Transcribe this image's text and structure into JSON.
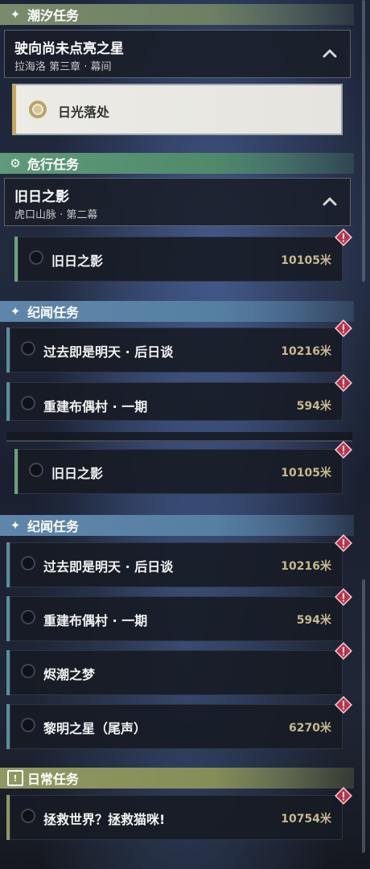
{
  "sections": {
    "tide": {
      "title": "潮汐任务",
      "icon": "sparkle-icon"
    },
    "danger": {
      "title": "危行任务",
      "icon": "gear-icon"
    },
    "story": {
      "title": "纪闻任务",
      "icon": "sparkle-icon"
    },
    "daily": {
      "title": "日常任务",
      "icon": "exclamation-badge-icon"
    }
  },
  "tide_chapter": {
    "title": "驶向尚未点亮之星",
    "subtitle": "拉海洛 第三章 · 幕间"
  },
  "tide_selected": {
    "name": "日光落处"
  },
  "danger_chapter": {
    "title": "旧日之影",
    "subtitle": "虎口山脉 · 第二幕"
  },
  "danger_task": {
    "name": "旧日之影",
    "distance": "10105米"
  },
  "story_tasks_top": [
    {
      "name": "过去即是明天 · 后日谈",
      "distance": "10216米"
    },
    {
      "name": "重建布偶村 · 一期",
      "distance": "594米"
    }
  ],
  "danger_task_repeat": {
    "name": "旧日之影",
    "distance": "10105米"
  },
  "story_tasks": [
    {
      "name": "过去即是明天 · 后日谈",
      "distance": "10216米"
    },
    {
      "name": "重建布偶村 · 一期",
      "distance": "594米"
    },
    {
      "name": "烬潮之梦",
      "distance": ""
    },
    {
      "name": "黎明之星（尾声）",
      "distance": "6270米"
    }
  ],
  "daily_task": {
    "name": "拯救世界？拯救猫咪!",
    "distance": "10754米"
  },
  "colors": {
    "alert": "#c0304a",
    "distance": "#c6b88f",
    "selected_accent": "#c6a85a"
  }
}
